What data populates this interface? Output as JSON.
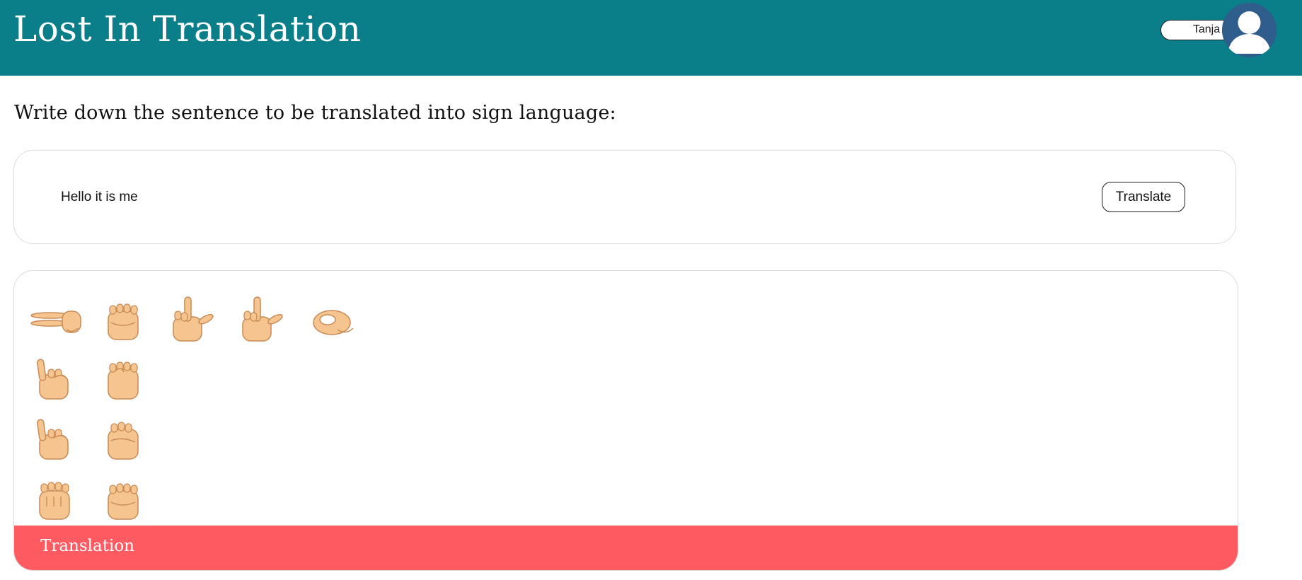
{
  "header": {
    "title": "Lost In Translation",
    "user_name": "Tanja",
    "avatar_icon": "user-avatar-icon",
    "background_color": "#0a7f8a"
  },
  "main": {
    "prompt": "Write down the sentence to be translated into sign language:",
    "input_value": "Hello it is me",
    "translate_label": "Translate",
    "output": {
      "rows": [
        {
          "word": "Hello",
          "signs": [
            "h",
            "e",
            "l",
            "l",
            "o"
          ]
        },
        {
          "word": "it",
          "signs": [
            "i",
            "t"
          ]
        },
        {
          "word": "is",
          "signs": [
            "i",
            "s"
          ]
        },
        {
          "word": "me",
          "signs": [
            "m",
            "e"
          ]
        }
      ],
      "footer_label": "Translation",
      "footer_color": "#fe5a62"
    }
  }
}
